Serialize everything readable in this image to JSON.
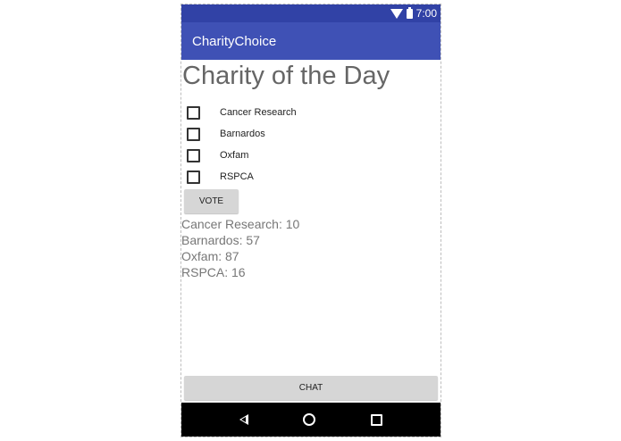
{
  "status_bar": {
    "time": "7:00",
    "icons": [
      "wifi-icon",
      "battery-icon"
    ],
    "background": "#3142a6"
  },
  "app_bar": {
    "title": "CharityChoice",
    "background": "#3f51b5"
  },
  "main": {
    "heading": "Charity of the Day",
    "options": [
      {
        "label": "Cancer Research",
        "checked": false
      },
      {
        "label": "Barnardos",
        "checked": false
      },
      {
        "label": "Oxfam",
        "checked": false
      },
      {
        "label": "RSPCA",
        "checked": false
      }
    ],
    "vote_label": "VOTE",
    "results": [
      "Cancer Research: 10",
      "Barnardos: 57",
      "Oxfam: 87",
      "RSPCA: 16"
    ],
    "chat_label": "CHAT"
  },
  "nav_bar": {
    "icons": [
      "back-icon",
      "home-icon",
      "recents-icon"
    ]
  }
}
